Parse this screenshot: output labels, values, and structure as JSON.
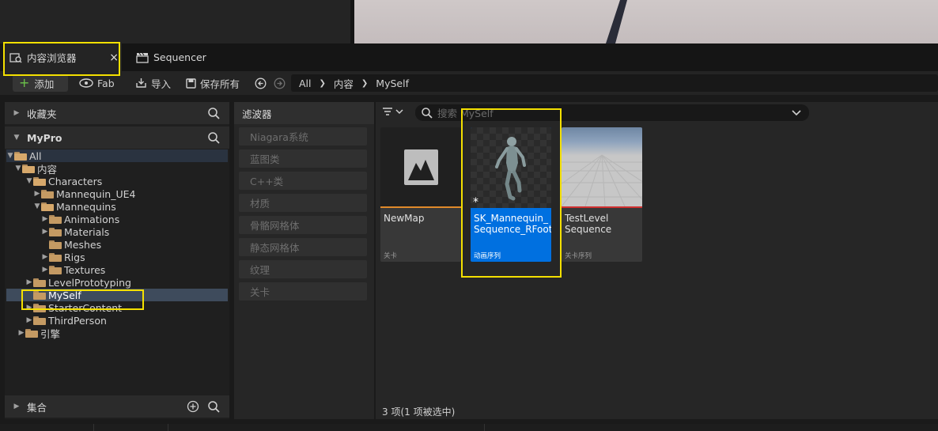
{
  "tabs": [
    {
      "label": "内容浏览器",
      "close": "×"
    },
    {
      "label": "Sequencer"
    }
  ],
  "toolbar": {
    "add_label": "添加",
    "fab_label": "Fab",
    "import_label": "导入",
    "save_all_label": "保存所有",
    "breadcrumb": [
      "All",
      "内容",
      "MySelf"
    ]
  },
  "sections": {
    "favorites": "收藏夹",
    "project": "MyPro",
    "collections": "集合"
  },
  "tree": [
    {
      "label": "All"
    },
    {
      "label": "内容"
    },
    {
      "label": "Characters"
    },
    {
      "label": "Mannequin_UE4"
    },
    {
      "label": "Mannequins"
    },
    {
      "label": "Animations"
    },
    {
      "label": "Materials"
    },
    {
      "label": "Meshes"
    },
    {
      "label": "Rigs"
    },
    {
      "label": "Textures"
    },
    {
      "label": "LevelPrototyping"
    },
    {
      "label": "MySelf"
    },
    {
      "label": "StarterContent"
    },
    {
      "label": "ThirdPerson"
    },
    {
      "label": "引擎"
    }
  ],
  "filters": {
    "title": "滤波器",
    "items": [
      "Niagara系统",
      "蓝图类",
      "C++类",
      "材质",
      "骨骼网格体",
      "静态网格体",
      "纹理",
      "关卡"
    ]
  },
  "search": {
    "placeholder": "搜索 MySelf"
  },
  "assets": [
    {
      "name": "NewMap",
      "type": "关卡",
      "accent": "#e08a2a"
    },
    {
      "name": "SK_Mannequin_ Sequence_RFoot",
      "type": "动画序列",
      "accent": "#0070e0"
    },
    {
      "name": "TestLevel Sequence",
      "type": "关卡序列",
      "accent": "#d03030"
    }
  ],
  "status": "3 项(1 项被选中)",
  "colors": {
    "highlight": "#f4e000",
    "selected_card": "#0070e0"
  }
}
